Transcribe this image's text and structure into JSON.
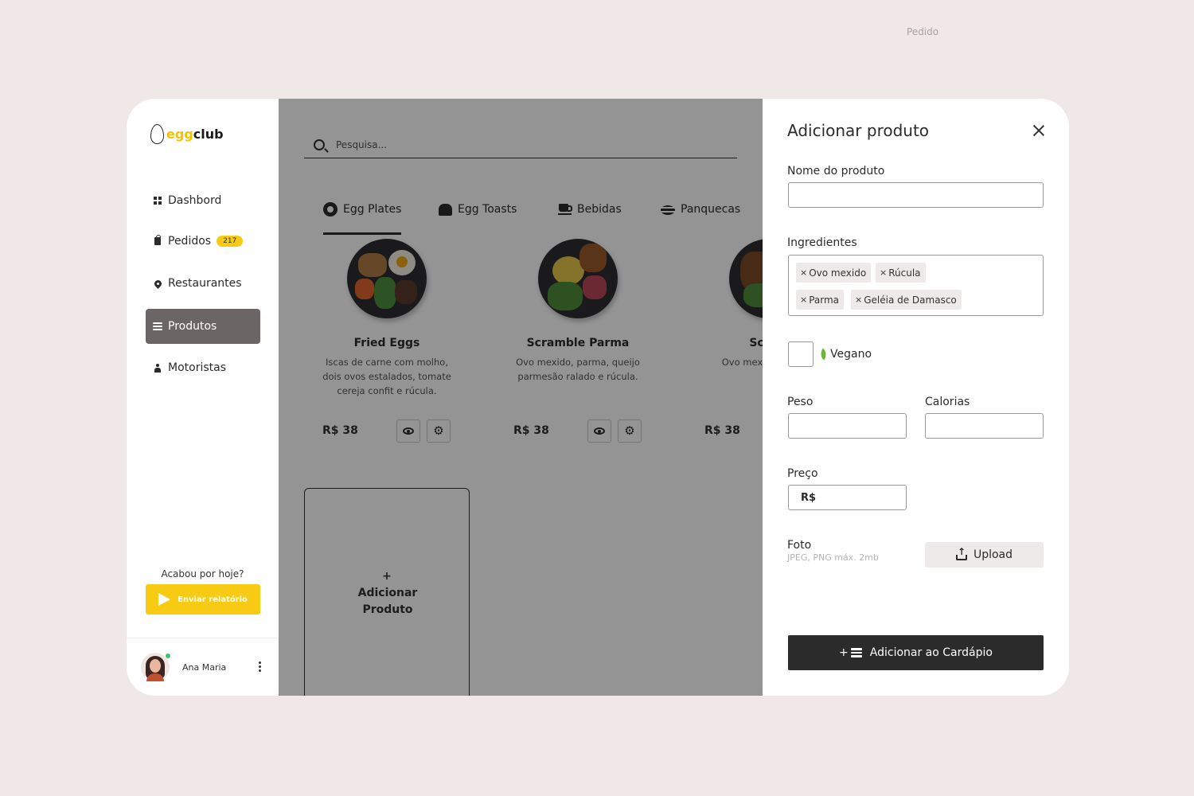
{
  "top_label": "Pedido",
  "brand": {
    "part1": "egg",
    "part2": "club"
  },
  "sidebar": {
    "items": [
      {
        "label": "Dashbord",
        "icon": "grid-icon"
      },
      {
        "label": "Pedidos",
        "icon": "bag-icon",
        "badge": "217"
      },
      {
        "label": "Restaurantes",
        "icon": "pin-icon"
      },
      {
        "label": "Produtos",
        "icon": "menu-stack-icon",
        "active": true
      },
      {
        "label": "Motoristas",
        "icon": "driver-icon"
      }
    ],
    "report_question": "Acabou por hoje?",
    "report_button": "Enviar relatório",
    "user_name": "Ana Maria"
  },
  "search": {
    "placeholder": "Pesquisa..."
  },
  "tabs": [
    {
      "label": "Egg Plates",
      "icon": "fried-egg-icon",
      "active": true
    },
    {
      "label": "Egg Toasts",
      "icon": "toast-icon"
    },
    {
      "label": "Bebidas",
      "icon": "coffee-cup-icon"
    },
    {
      "label": "Panquecas",
      "icon": "pancake-icon"
    }
  ],
  "products": [
    {
      "title": "Fried Eggs",
      "description": "Iscas de carne com molho, dois ovos estalados, tomate cereja confit e rúcula.",
      "price": "R$ 38"
    },
    {
      "title": "Scramble Parma",
      "description": "Ovo mexido, parma, queijo parmesão ralado e rúcula.",
      "price": "R$ 38"
    },
    {
      "title": "Scram",
      "description": "Ovo mexid geléia de",
      "price": "R$ 38"
    }
  ],
  "add_product_card": {
    "plus": "+",
    "label": "Adicionar Produto"
  },
  "panel": {
    "title": "Adicionar produto",
    "name_label": "Nome do produto",
    "name_value": "",
    "ingredients_label": "Ingredientes",
    "ingredients": [
      "Ovo mexido",
      "Rúcula",
      "Parma",
      "Geléia de Damasco"
    ],
    "chip_remove": "×",
    "vegan_label": "Vegano",
    "vegan_checked": false,
    "weight_label": "Peso",
    "calories_label": "Calorias",
    "price_label": "Preço",
    "price_prefix": "R$",
    "photo_label": "Foto",
    "photo_hint": "JPEG, PNG máx. 2mb",
    "upload_button": "Upload",
    "submit_button": "Adicionar ao Cardápio",
    "submit_plus": "+"
  },
  "colors": {
    "accent_yellow": "#f7cb14",
    "dark": "#2b2b2b",
    "active_nav": "#6b6565",
    "online": "#3cc46a",
    "vegan_leaf": "#6fb33a"
  }
}
